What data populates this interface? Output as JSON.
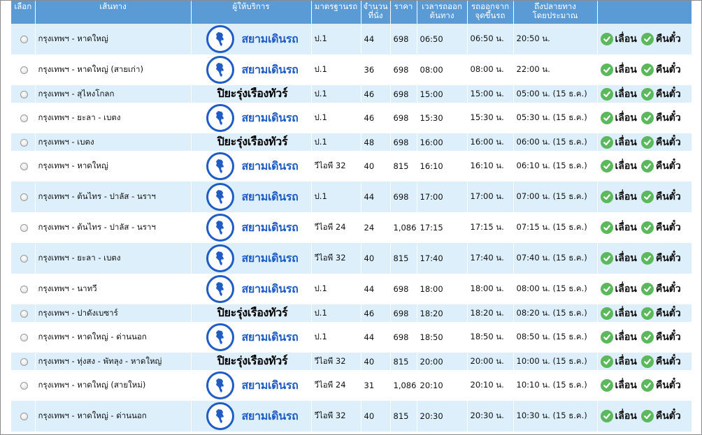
{
  "headers": {
    "select": "เลือก",
    "route": "เส้นทาง",
    "operator": "ผู้ให้บริการ",
    "standard": "มาตรฐานรถ",
    "seats_1": "จำนวน",
    "seats_2": "ที่นั่ง",
    "price": "ราคา",
    "depart_1": "เวลารถออก",
    "depart_2": "ต้นทาง",
    "board_1": "รถออกจาก",
    "board_2": "จุดขึ้นรถ",
    "arrive_1": "ถึงปลายทาง",
    "arrive_2": "โดยประมาณ"
  },
  "operators": {
    "siam": "สยามเดินรถ",
    "piya": "ปิยะรุ่งเรืองทัวร์"
  },
  "actions": {
    "postpone": "เลื่อน",
    "refund": "คืนตั๋ว"
  },
  "colors": {
    "header_bg": "#5b9bd5",
    "row_alt_bg": "#ddeffb",
    "brand_blue": "#1f5cc6",
    "check_green": "#5cb85c"
  },
  "rows": [
    {
      "route": "กรุงเทพฯ - หาดใหญ่",
      "operator": "siam",
      "standard": "ป.1",
      "seats": "44",
      "price": "698",
      "depart": "06:50",
      "board": "06:50 น.",
      "arrive": "20:50 น."
    },
    {
      "route": "กรุงเทพฯ - หาดใหญ่ (สายเก่า)",
      "operator": "siam",
      "standard": "ป.1",
      "seats": "36",
      "price": "698",
      "depart": "08:00",
      "board": "08:00 น.",
      "arrive": "22:00 น."
    },
    {
      "route": "กรุงเทพฯ - สุไหงโกลก",
      "operator": "piya",
      "standard": "ป.1",
      "seats": "46",
      "price": "698",
      "depart": "15:00",
      "board": "15:00 น.",
      "arrive": "05:00 น. (15 ธ.ค.)"
    },
    {
      "route": "กรุงเทพฯ - ยะลา - เบตง",
      "operator": "siam",
      "standard": "ป.1",
      "seats": "46",
      "price": "698",
      "depart": "15:30",
      "board": "15:30 น.",
      "arrive": "05:30 น. (15 ธ.ค.)"
    },
    {
      "route": "กรุงเทพฯ - เบตง",
      "operator": "piya",
      "standard": "ป.1",
      "seats": "48",
      "price": "698",
      "depart": "16:00",
      "board": "16:00 น.",
      "arrive": "06:00 น. (15 ธ.ค.)"
    },
    {
      "route": "กรุงเทพฯ - หาดใหญ่",
      "operator": "siam",
      "standard": "วีไอพี 32",
      "seats": "40",
      "price": "815",
      "depart": "16:10",
      "board": "16:10 น.",
      "arrive": "06:10 น. (15 ธ.ค.)"
    },
    {
      "route": "กรุงเทพฯ - ต้นไทร - ปาลัส - นราฯ",
      "operator": "siam",
      "standard": "ป.1",
      "seats": "44",
      "price": "698",
      "depart": "17:00",
      "board": "17:00 น.",
      "arrive": "07:00 น. (15 ธ.ค.)"
    },
    {
      "route": "กรุงเทพฯ - ต้นไทร - ปาลัส - นราฯ",
      "operator": "siam",
      "standard": "วีไอพี 24",
      "seats": "24",
      "price": "1,086",
      "depart": "17:15",
      "board": "17:15 น.",
      "arrive": "07:15 น. (15 ธ.ค.)"
    },
    {
      "route": "กรุงเทพฯ - ยะลา - เบตง",
      "operator": "siam",
      "standard": "วีไอพี 32",
      "seats": "40",
      "price": "815",
      "depart": "17:40",
      "board": "17:40 น.",
      "arrive": "07:40 น. (15 ธ.ค.)"
    },
    {
      "route": "กรุงเทพฯ - นาทวี",
      "operator": "siam",
      "standard": "ป.1",
      "seats": "44",
      "price": "698",
      "depart": "18:00",
      "board": "18:00 น.",
      "arrive": "08:00 น. (15 ธ.ค.)"
    },
    {
      "route": "กรุงเทพฯ - ปาดังเบซาร์",
      "operator": "piya",
      "standard": "ป.1",
      "seats": "46",
      "price": "698",
      "depart": "18:20",
      "board": "18:20 น.",
      "arrive": "08:20 น. (15 ธ.ค.)"
    },
    {
      "route": "กรุงเทพฯ - หาดใหญ่ - ด่านนอก",
      "operator": "siam",
      "standard": "ป.1",
      "seats": "44",
      "price": "698",
      "depart": "18:50",
      "board": "18:50 น.",
      "arrive": "08:50 น. (15 ธ.ค.)"
    },
    {
      "route": "กรุงเทพฯ - ทุ่งสง - พัทลุง - หาดใหญ่",
      "operator": "piya",
      "standard": "วีไอพี 32",
      "seats": "40",
      "price": "815",
      "depart": "20:00",
      "board": "20:00 น.",
      "arrive": "10:00 น. (15 ธ.ค.)"
    },
    {
      "route": "กรุงเทพฯ - หาดใหญ่ (สายใหม่)",
      "operator": "siam",
      "standard": "วีไอพี 24",
      "seats": "31",
      "price": "1,086",
      "depart": "20:10",
      "board": "20:10 น.",
      "arrive": "10:10 น. (15 ธ.ค.)"
    },
    {
      "route": "กรุงเทพฯ - หาดใหญ่ - ด่านนอก",
      "operator": "siam",
      "standard": "วีไอพี 32",
      "seats": "40",
      "price": "815",
      "depart": "20:30",
      "board": "20:30 น.",
      "arrive": "10:30 น. (15 ธ.ค.)"
    }
  ]
}
